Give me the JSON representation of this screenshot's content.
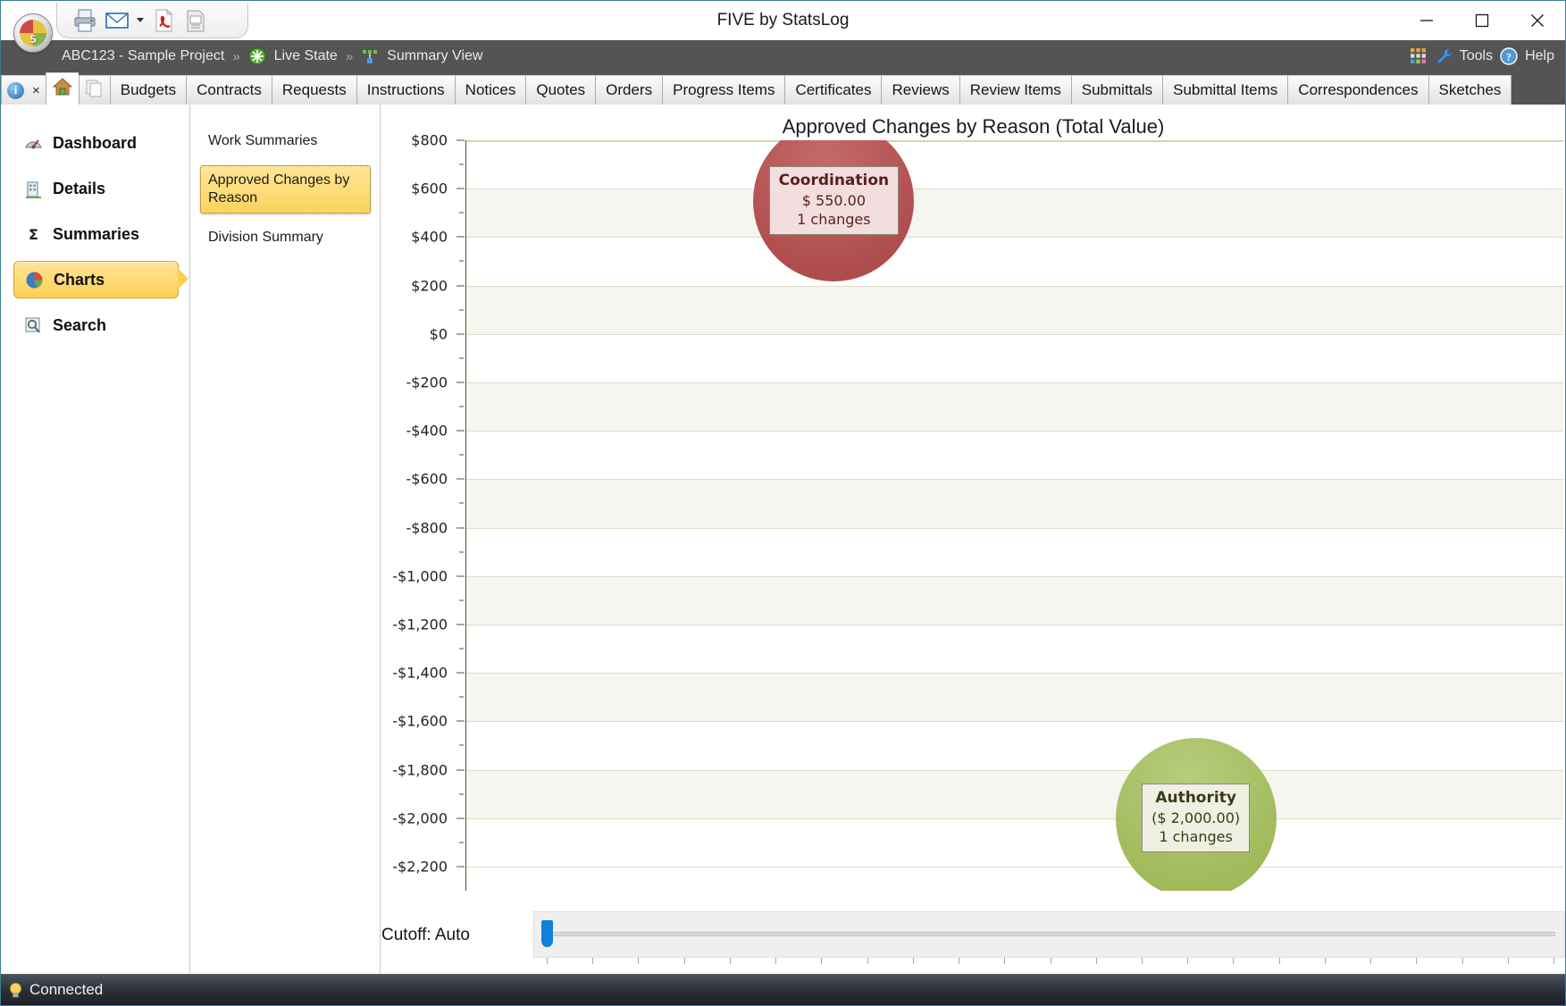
{
  "window": {
    "title": "FIVE by StatsLog",
    "minimize_label": "minimize-icon",
    "maximize_label": "maximize-icon",
    "close_label": "close-icon",
    "orb_number": "5"
  },
  "quick_access_toolbar": {
    "items": [
      {
        "name": "print-icon",
        "label": "Print"
      },
      {
        "name": "email-icon",
        "label": "Email"
      },
      {
        "name": "email-dropdown-caret",
        "label": "Email options"
      },
      {
        "name": "pdf-icon",
        "label": "Export PDF"
      },
      {
        "name": "report-icon",
        "label": "Export Report"
      }
    ]
  },
  "breadcrumb": {
    "project": "ABC123 - Sample Project",
    "sep1": "»",
    "state": "Live State",
    "sep2": "»",
    "view": "Summary View"
  },
  "header_right": {
    "apps_icon": "apps-grid-icon",
    "tools": "Tools",
    "help": "Help"
  },
  "tabs": {
    "system": [
      {
        "name": "info-tab",
        "label": ""
      },
      {
        "name": "close-tab",
        "label": "×"
      },
      {
        "name": "home-tab",
        "label": ""
      },
      {
        "name": "copy-tab",
        "label": ""
      }
    ],
    "items": [
      "Budgets",
      "Contracts",
      "Requests",
      "Instructions",
      "Notices",
      "Quotes",
      "Orders",
      "Progress Items",
      "Certificates",
      "Reviews",
      "Review Items",
      "Submittals",
      "Submittal Items",
      "Correspondences",
      "Sketches"
    ],
    "active": "home-tab"
  },
  "sidebar": {
    "items": [
      {
        "label": "Dashboard",
        "icon": "gauge-icon",
        "active": false
      },
      {
        "label": "Details",
        "icon": "building-icon",
        "active": false
      },
      {
        "label": "Summaries",
        "icon": "sigma-icon",
        "active": false
      },
      {
        "label": "Charts",
        "icon": "pie-chart-icon",
        "active": true
      },
      {
        "label": "Search",
        "icon": "magnifier-icon",
        "active": false
      }
    ]
  },
  "chart_list": {
    "items": [
      {
        "label": "Work Summaries",
        "selected": false
      },
      {
        "label": "Approved Changes by Reason",
        "selected": true
      },
      {
        "label": "Division Summary",
        "selected": false
      }
    ]
  },
  "cutoff": {
    "label": "Cutoff: Auto",
    "slider_value": 0
  },
  "statusbar": {
    "icon": "bulb-icon",
    "text": "Connected"
  },
  "chart_data": {
    "type": "scatter",
    "title": "Approved Changes by Reason (Total Value)",
    "xlabel": "",
    "ylabel": "",
    "ylim": [
      -2300,
      800
    ],
    "grid": true,
    "legend": "none",
    "ytick_labels": [
      "$800",
      "$600",
      "$400",
      "$200",
      "$0",
      "-$200",
      "-$400",
      "-$600",
      "-$800",
      "-$1,000",
      "-$1,200",
      "-$1,400",
      "-$1,600",
      "-$1,800",
      "-$2,000",
      "-$2,200"
    ],
    "ytick_values": [
      800,
      600,
      400,
      200,
      0,
      -200,
      -400,
      -600,
      -800,
      -1000,
      -1200,
      -1400,
      -1600,
      -1800,
      -2000,
      -2200
    ],
    "points": [
      {
        "name": "Coordination",
        "value": 550,
        "value_label": "$ 550.00",
        "count": 1,
        "count_label": "1 changes",
        "color": "#b04e4e",
        "label_bg": "#f2dede",
        "x_pct": 33.5,
        "radius_px": 90
      },
      {
        "name": "Authority",
        "value": -2000,
        "value_label": "($ 2,000.00)",
        "count": 1,
        "count_label": "1 changes",
        "color": "#a2bb5c",
        "label_bg": "#eff0e3",
        "x_pct": 66.5,
        "radius_px": 90
      }
    ]
  }
}
